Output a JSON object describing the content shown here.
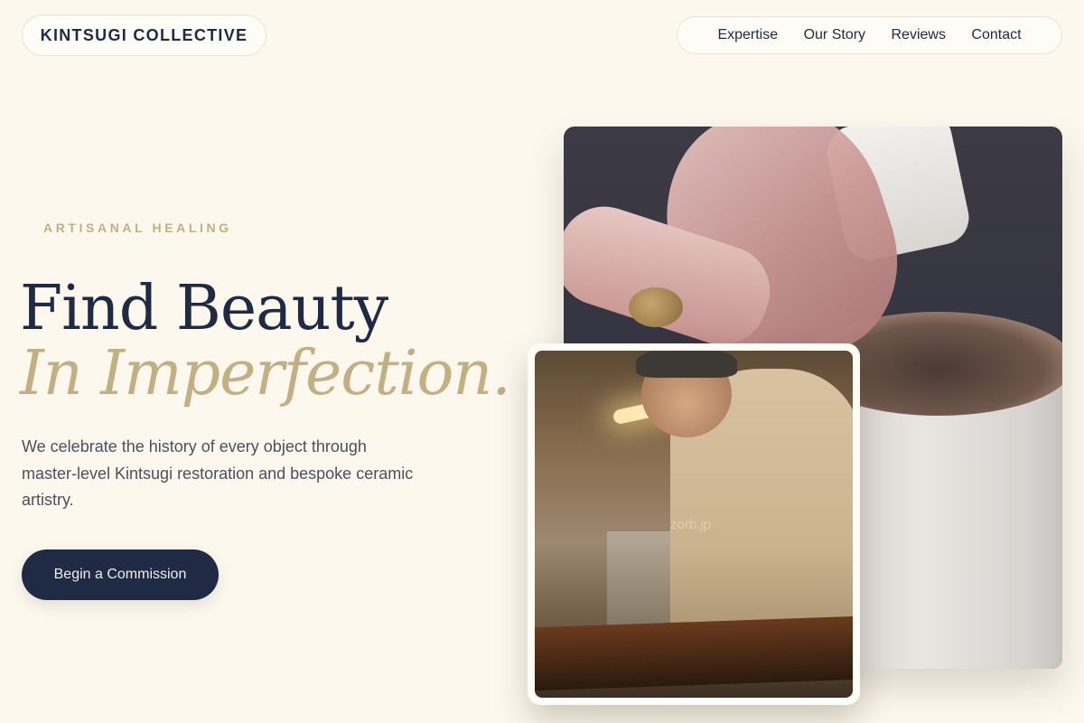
{
  "brand": {
    "name": "KINTSUGI COLLECTIVE"
  },
  "nav": {
    "items": [
      {
        "label": "Expertise"
      },
      {
        "label": "Our Story"
      },
      {
        "label": "Reviews"
      },
      {
        "label": "Contact"
      }
    ]
  },
  "hero": {
    "eyebrow": "ARTISANAL HEALING",
    "headline_line1": "Find Beauty",
    "headline_line2": "In Imperfection.",
    "lede": "We celebrate the history of every object through master-level Kintsugi restoration and bespoke ceramic artistry.",
    "cta_label": "Begin a Commission"
  },
  "images": {
    "main_alt": "Hands shaping a clay pot on a pottery wheel",
    "inset_alt": "Craftsman working at a workbench in a dusty workshop",
    "inset_watermark": "zorb.jp"
  },
  "colors": {
    "background": "#fdf8ee",
    "navy": "#1f2a44",
    "gold": "#c2b083",
    "body_text": "#4a505c"
  }
}
